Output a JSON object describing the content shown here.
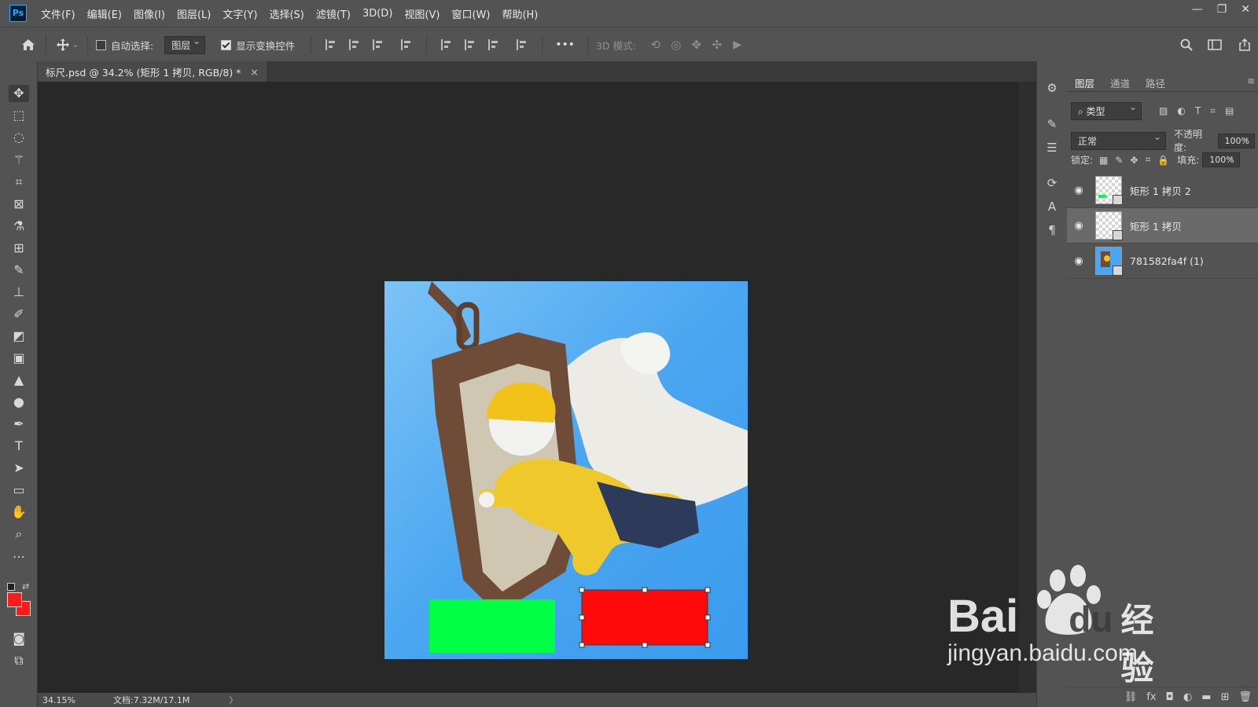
{
  "app": {
    "logo": "Ps"
  },
  "menu": [
    "文件(F)",
    "编辑(E)",
    "图像(I)",
    "图层(L)",
    "文字(Y)",
    "选择(S)",
    "滤镜(T)",
    "3D(D)",
    "视图(V)",
    "窗口(W)",
    "帮助(H)"
  ],
  "options": {
    "auto_select_label": "自动选择:",
    "auto_select_checked": false,
    "auto_select_value": "图层",
    "show_transform_label": "显示变换控件",
    "show_transform_checked": true,
    "more": "•••",
    "mode_3d_label": "3D 模式:"
  },
  "document": {
    "tab_title": "标尺.psd @ 34.2% (矩形 1 拷贝, RGB/8) *",
    "close": "×"
  },
  "status": {
    "zoom": "34.15%",
    "doc_size": "文档:7.32M/17.1M",
    "arrow": "〉"
  },
  "layers_panel": {
    "tabs": [
      "图层",
      "通道",
      "路径"
    ],
    "active_tab": "图层",
    "filter_kind": "类型",
    "blend_mode": "正常",
    "opacity_label": "不透明度:",
    "opacity_value": "100%",
    "lock_label": "锁定:",
    "fill_label": "填充:",
    "fill_value": "100%",
    "layers": [
      {
        "name": "矩形 1 拷贝 2",
        "visible": true,
        "selected": false
      },
      {
        "name": "矩形 1 拷贝",
        "visible": true,
        "selected": true
      },
      {
        "name": "781582fa4f (1)",
        "visible": true,
        "selected": false
      }
    ]
  },
  "colors": {
    "foreground": "#ff1a1a",
    "background": "#ff1a1a",
    "green_rect": "#00ff44",
    "red_rect": "#ff0a0a",
    "sky": "#4ea8f2"
  },
  "watermark": {
    "brand": "Bai",
    "brand_suffix": "du",
    "cn": "经验",
    "url": "jingyan.baidu.com"
  }
}
